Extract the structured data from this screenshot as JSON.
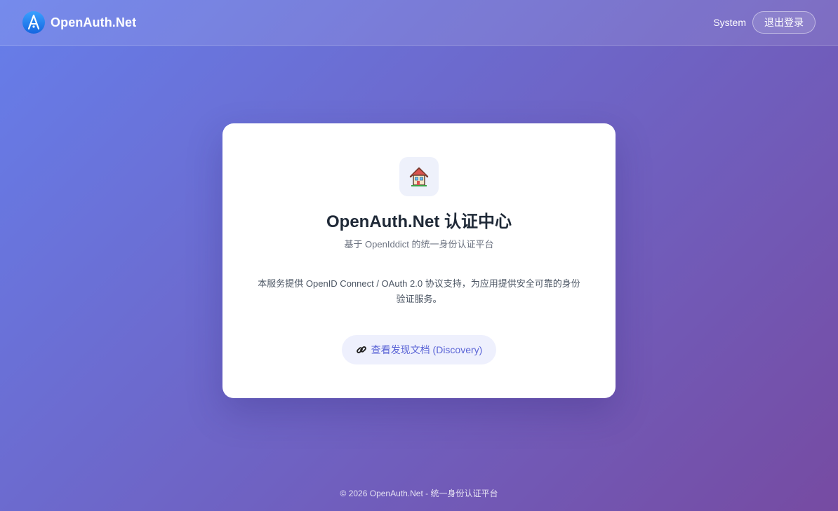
{
  "header": {
    "brand_name": "OpenAuth.Net",
    "logo_icon": "openauth-logo-icon",
    "username": "System",
    "logout_label": "退出登录"
  },
  "card": {
    "icon": "house-icon",
    "title": "OpenAuth.Net 认证中心",
    "subtitle": "基于 OpenIddict 的统一身份认证平台",
    "description": "本服务提供 OpenID Connect / OAuth 2.0 协议支持，为应用提供安全可靠的身份验证服务。",
    "discovery_icon": "link-icon",
    "discovery_label": "查看发现文档 (Discovery)"
  },
  "footer": {
    "text": "© 2026 OpenAuth.Net - 统一身份认证平台"
  },
  "colors": {
    "gradient_start": "#667eea",
    "gradient_end": "#764ba2",
    "link_text": "#5a64d6",
    "link_bg": "#eef0fd"
  }
}
